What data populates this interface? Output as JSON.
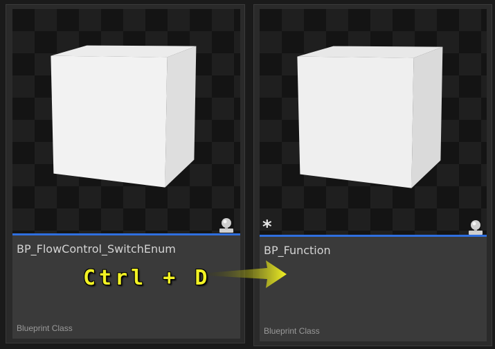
{
  "cards": [
    {
      "name": "BP_FlowControl_SwitchEnum",
      "type": "Blueprint Class",
      "modified": false
    },
    {
      "name": "BP_Function",
      "type": "Blueprint Class",
      "modified": true,
      "modified_marker": "*"
    }
  ],
  "annotation": {
    "shortcut": "Ctrl + D",
    "color": "#f2f224"
  },
  "colors": {
    "accent": "#2f6fe0",
    "card_bg": "#3a3a3a"
  },
  "icons": {
    "thumbnail_capture": "camera-capture-icon",
    "arrow": "arrow-right-icon"
  }
}
